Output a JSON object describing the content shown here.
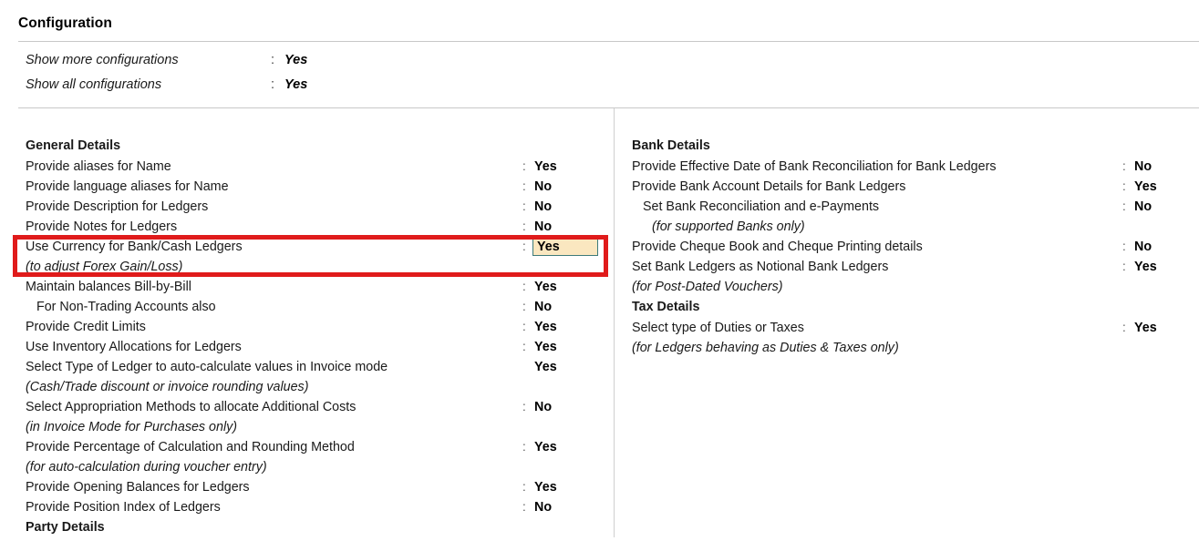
{
  "header": {
    "title": "Configuration"
  },
  "top_config": [
    {
      "label": "Show more configurations",
      "colon": ":",
      "value": "Yes"
    },
    {
      "label": "Show all configurations",
      "colon": ":",
      "value": "Yes"
    }
  ],
  "left_column": [
    {
      "type": "section",
      "label": "General Details"
    },
    {
      "type": "row",
      "label": "Provide aliases for Name",
      "colon": ":",
      "value": "Yes"
    },
    {
      "type": "row",
      "label": "Provide language aliases for Name",
      "colon": ":",
      "value": "No"
    },
    {
      "type": "row",
      "label": "Provide Description for Ledgers",
      "colon": ":",
      "value": "No"
    },
    {
      "type": "row",
      "label": "Provide Notes for Ledgers",
      "colon": ":",
      "value": "No"
    },
    {
      "type": "row",
      "label": "Use Currency for Bank/Cash Ledgers",
      "colon": ":",
      "value": "Yes",
      "highlighted": true
    },
    {
      "type": "hint",
      "label": "(to adjust Forex Gain/Loss)"
    },
    {
      "type": "row",
      "label": "Maintain balances Bill-by-Bill",
      "colon": ":",
      "value": "Yes"
    },
    {
      "type": "row",
      "indent": 1,
      "label": "For Non-Trading Accounts also",
      "colon": ":",
      "value": "No"
    },
    {
      "type": "row",
      "label": "Provide Credit Limits",
      "colon": ":",
      "value": "Yes"
    },
    {
      "type": "row",
      "label": "Use Inventory Allocations for Ledgers",
      "colon": ":",
      "value": "Yes"
    },
    {
      "type": "row",
      "label": "Select Type of Ledger to auto-calculate values in Invoice mode",
      "colon": "",
      "value": "Yes"
    },
    {
      "type": "hint",
      "label": "(Cash/Trade discount or invoice rounding values)"
    },
    {
      "type": "row",
      "label": "Select Appropriation Methods to allocate Additional Costs",
      "colon": ":",
      "value": "No"
    },
    {
      "type": "hint",
      "label": "(in Invoice Mode for Purchases only)"
    },
    {
      "type": "row",
      "label": "Provide Percentage of Calculation and Rounding Method",
      "colon": ":",
      "value": "Yes"
    },
    {
      "type": "hint",
      "label": "(for auto-calculation during voucher entry)"
    },
    {
      "type": "row",
      "label": "Provide Opening Balances for Ledgers",
      "colon": ":",
      "value": "Yes"
    },
    {
      "type": "row",
      "label": "Provide Position Index of Ledgers",
      "colon": ":",
      "value": "No"
    },
    {
      "type": "section",
      "label": "Party Details"
    }
  ],
  "right_column": [
    {
      "type": "section",
      "label": "Bank Details"
    },
    {
      "type": "row",
      "label": "Provide Effective Date of Bank Reconciliation for Bank Ledgers",
      "colon": ":",
      "value": "No"
    },
    {
      "type": "row",
      "label": "Provide Bank Account Details for Bank Ledgers",
      "colon": ":",
      "value": "Yes"
    },
    {
      "type": "row",
      "indent": 1,
      "label": "Set Bank Reconciliation and e-Payments",
      "colon": ":",
      "value": "No"
    },
    {
      "type": "hint",
      "indent": 2,
      "label": "(for supported Banks only)"
    },
    {
      "type": "row",
      "label": "Provide Cheque Book and Cheque Printing details",
      "colon": ":",
      "value": "No"
    },
    {
      "type": "row",
      "label": "Set Bank Ledgers as Notional Bank Ledgers",
      "colon": ":",
      "value": "Yes"
    },
    {
      "type": "hint",
      "label": "(for Post-Dated Vouchers)"
    },
    {
      "type": "section",
      "label": "Tax Details"
    },
    {
      "type": "row",
      "label": "Select type of Duties or Taxes",
      "colon": ":",
      "value": "Yes"
    },
    {
      "type": "hint",
      "label": "(for Ledgers behaving as Duties & Taxes only)"
    }
  ],
  "colors": {
    "annotation_red": "#e01b1b",
    "highlight_background": "#fae7c0",
    "highlight_border": "#3d7a7a",
    "divider": "#cfcfcf",
    "text": "#1a1a1a"
  }
}
